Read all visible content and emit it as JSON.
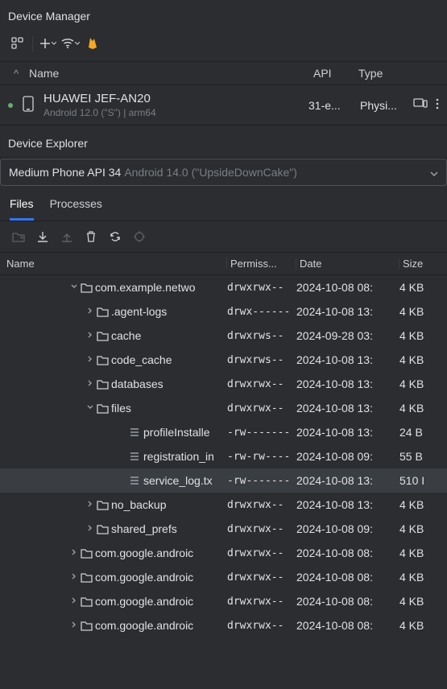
{
  "deviceManager": {
    "title": "Device Manager",
    "header": {
      "sorter": "^",
      "name": "Name",
      "api": "API",
      "type": "Type"
    },
    "device": {
      "name": "HUAWEI JEF-AN20",
      "sub": "Android 12.0 (\"S\") | arm64",
      "api": "31-e...",
      "type": "Physi..."
    }
  },
  "explorer": {
    "title": "Device Explorer",
    "selector": {
      "primary": "Medium Phone API 34",
      "secondary": "Android 14.0 (\"UpsideDownCake\")"
    },
    "tabs": {
      "files": "Files",
      "processes": "Processes"
    },
    "columns": {
      "name": "Name",
      "perm": "Permiss...",
      "date": "Date",
      "size": "Size"
    },
    "rows": [
      {
        "indent": 80,
        "twisty": "down",
        "kind": "folder",
        "name": "com.example.netwo",
        "perm": "drwxrwx--",
        "date": "2024-10-08 08:",
        "size": "4 KB"
      },
      {
        "indent": 100,
        "twisty": "right",
        "kind": "folder",
        "name": ".agent-logs",
        "perm": "drwx------",
        "date": "2024-10-08 13:",
        "size": "4 KB"
      },
      {
        "indent": 100,
        "twisty": "right",
        "kind": "folder",
        "name": "cache",
        "perm": "drwxrws--",
        "date": "2024-09-28 03:",
        "size": "4 KB"
      },
      {
        "indent": 100,
        "twisty": "right",
        "kind": "folder",
        "name": "code_cache",
        "perm": "drwxrws--",
        "date": "2024-10-08 13:",
        "size": "4 KB"
      },
      {
        "indent": 100,
        "twisty": "right",
        "kind": "folder",
        "name": "databases",
        "perm": "drwxrwx--",
        "date": "2024-10-08 13:",
        "size": "4 KB"
      },
      {
        "indent": 100,
        "twisty": "down",
        "kind": "folder",
        "name": "files",
        "perm": "drwxrwx--",
        "date": "2024-10-08 13:",
        "size": "4 KB"
      },
      {
        "indent": 140,
        "twisty": "none",
        "kind": "file",
        "name": "profileInstalle",
        "perm": "-rw-------",
        "date": "2024-10-08 13:",
        "size": "24 B"
      },
      {
        "indent": 140,
        "twisty": "none",
        "kind": "file",
        "name": "registration_in",
        "perm": "-rw-rw----",
        "date": "2024-10-08 09:",
        "size": "55 B"
      },
      {
        "indent": 140,
        "twisty": "none",
        "kind": "file",
        "name": "service_log.tx",
        "perm": "-rw-------",
        "date": "2024-10-08 13:",
        "size": "510 I",
        "selected": true
      },
      {
        "indent": 100,
        "twisty": "right",
        "kind": "folder",
        "name": "no_backup",
        "perm": "drwxrwx--",
        "date": "2024-10-08 13:",
        "size": "4 KB"
      },
      {
        "indent": 100,
        "twisty": "right",
        "kind": "folder",
        "name": "shared_prefs",
        "perm": "drwxrwx--",
        "date": "2024-10-08 09:",
        "size": "4 KB"
      },
      {
        "indent": 80,
        "twisty": "right",
        "kind": "folder",
        "name": "com.google.androic",
        "perm": "drwxrwx--",
        "date": "2024-10-08 08:",
        "size": "4 KB"
      },
      {
        "indent": 80,
        "twisty": "right",
        "kind": "folder",
        "name": "com.google.androic",
        "perm": "drwxrwx--",
        "date": "2024-10-08 08:",
        "size": "4 KB"
      },
      {
        "indent": 80,
        "twisty": "right",
        "kind": "folder",
        "name": "com.google.androic",
        "perm": "drwxrwx--",
        "date": "2024-10-08 08:",
        "size": "4 KB"
      },
      {
        "indent": 80,
        "twisty": "right",
        "kind": "folder",
        "name": "com.google.androic",
        "perm": "drwxrwx--",
        "date": "2024-10-08 08:",
        "size": "4 KB"
      }
    ]
  }
}
